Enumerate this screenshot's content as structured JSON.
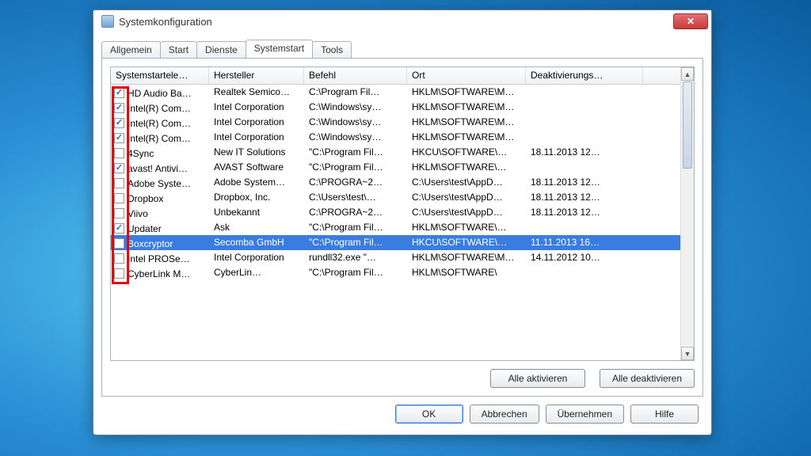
{
  "window": {
    "title": "Systemkonfiguration"
  },
  "tabs": [
    {
      "label": "Allgemein"
    },
    {
      "label": "Start"
    },
    {
      "label": "Dienste"
    },
    {
      "label": "Systemstart",
      "active": true
    },
    {
      "label": "Tools"
    }
  ],
  "columns": {
    "c0": "Systemstartele…",
    "c1": "Hersteller",
    "c2": "Befehl",
    "c3": "Ort",
    "c4": "Deaktivierungs…"
  },
  "rows": [
    {
      "checked": true,
      "name": "HD Audio Ba…",
      "vendor": "Realtek Semico…",
      "cmd": "C:\\Program Fil…",
      "loc": "HKLM\\SOFTWARE\\M…",
      "date": ""
    },
    {
      "checked": true,
      "name": "Intel(R) Com…",
      "vendor": "Intel Corporation",
      "cmd": "C:\\Windows\\sy…",
      "loc": "HKLM\\SOFTWARE\\M…",
      "date": ""
    },
    {
      "checked": true,
      "name": "Intel(R) Com…",
      "vendor": "Intel Corporation",
      "cmd": "C:\\Windows\\sy…",
      "loc": "HKLM\\SOFTWARE\\M…",
      "date": ""
    },
    {
      "checked": true,
      "name": "Intel(R) Com…",
      "vendor": "Intel Corporation",
      "cmd": "C:\\Windows\\sy…",
      "loc": "HKLM\\SOFTWARE\\M…",
      "date": ""
    },
    {
      "checked": false,
      "name": "4Sync",
      "vendor": "New IT Solutions",
      "cmd": "\"C:\\Program Fil…",
      "loc": "HKCU\\SOFTWARE\\…",
      "date": "18.11.2013 12…"
    },
    {
      "checked": true,
      "name": "avast! Antivi…",
      "vendor": "AVAST Software",
      "cmd": "\"C:\\Program Fil…",
      "loc": "HKLM\\SOFTWARE\\…",
      "date": ""
    },
    {
      "checked": false,
      "name": "Adobe Syste…",
      "vendor": "Adobe System…",
      "cmd": "C:\\PROGRA~2…",
      "loc": "C:\\Users\\test\\AppD…",
      "date": "18.11.2013 12…"
    },
    {
      "checked": false,
      "name": "Dropbox",
      "vendor": "Dropbox, Inc.",
      "cmd": "C:\\Users\\test\\…",
      "loc": "C:\\Users\\test\\AppD…",
      "date": "18.11.2013 12…"
    },
    {
      "checked": false,
      "name": "Viivo",
      "vendor": "Unbekannt",
      "cmd": "C:\\PROGRA~2…",
      "loc": "C:\\Users\\test\\AppD…",
      "date": "18.11.2013 12…"
    },
    {
      "checked": true,
      "name": "Updater",
      "vendor": "Ask",
      "cmd": "\"C:\\Program Fil…",
      "loc": "HKLM\\SOFTWARE\\…",
      "date": ""
    },
    {
      "checked": false,
      "selected": true,
      "name": "Boxcryptor",
      "vendor": "Secomba GmbH",
      "cmd": "\"C:\\Program Fil…",
      "loc": "HKCU\\SOFTWARE\\…",
      "date": "11.11.2013 16…"
    },
    {
      "checked": false,
      "name": "Intel PROSe…",
      "vendor": "Intel Corporation",
      "cmd": "rundll32.exe \"…",
      "loc": "HKLM\\SOFTWARE\\M…",
      "date": "14.11.2012 10…"
    },
    {
      "checked": false,
      "name": "CyberLink M…",
      "vendor": "CyberLin…",
      "cmd": "\"C:\\Program Fil…",
      "loc": "HKLM\\SOFTWARE\\",
      "date": ""
    }
  ],
  "buttons": {
    "enable_all": "Alle aktivieren",
    "disable_all": "Alle deaktivieren",
    "ok": "OK",
    "cancel": "Abbrechen",
    "apply": "Übernehmen",
    "help": "Hilfe"
  }
}
